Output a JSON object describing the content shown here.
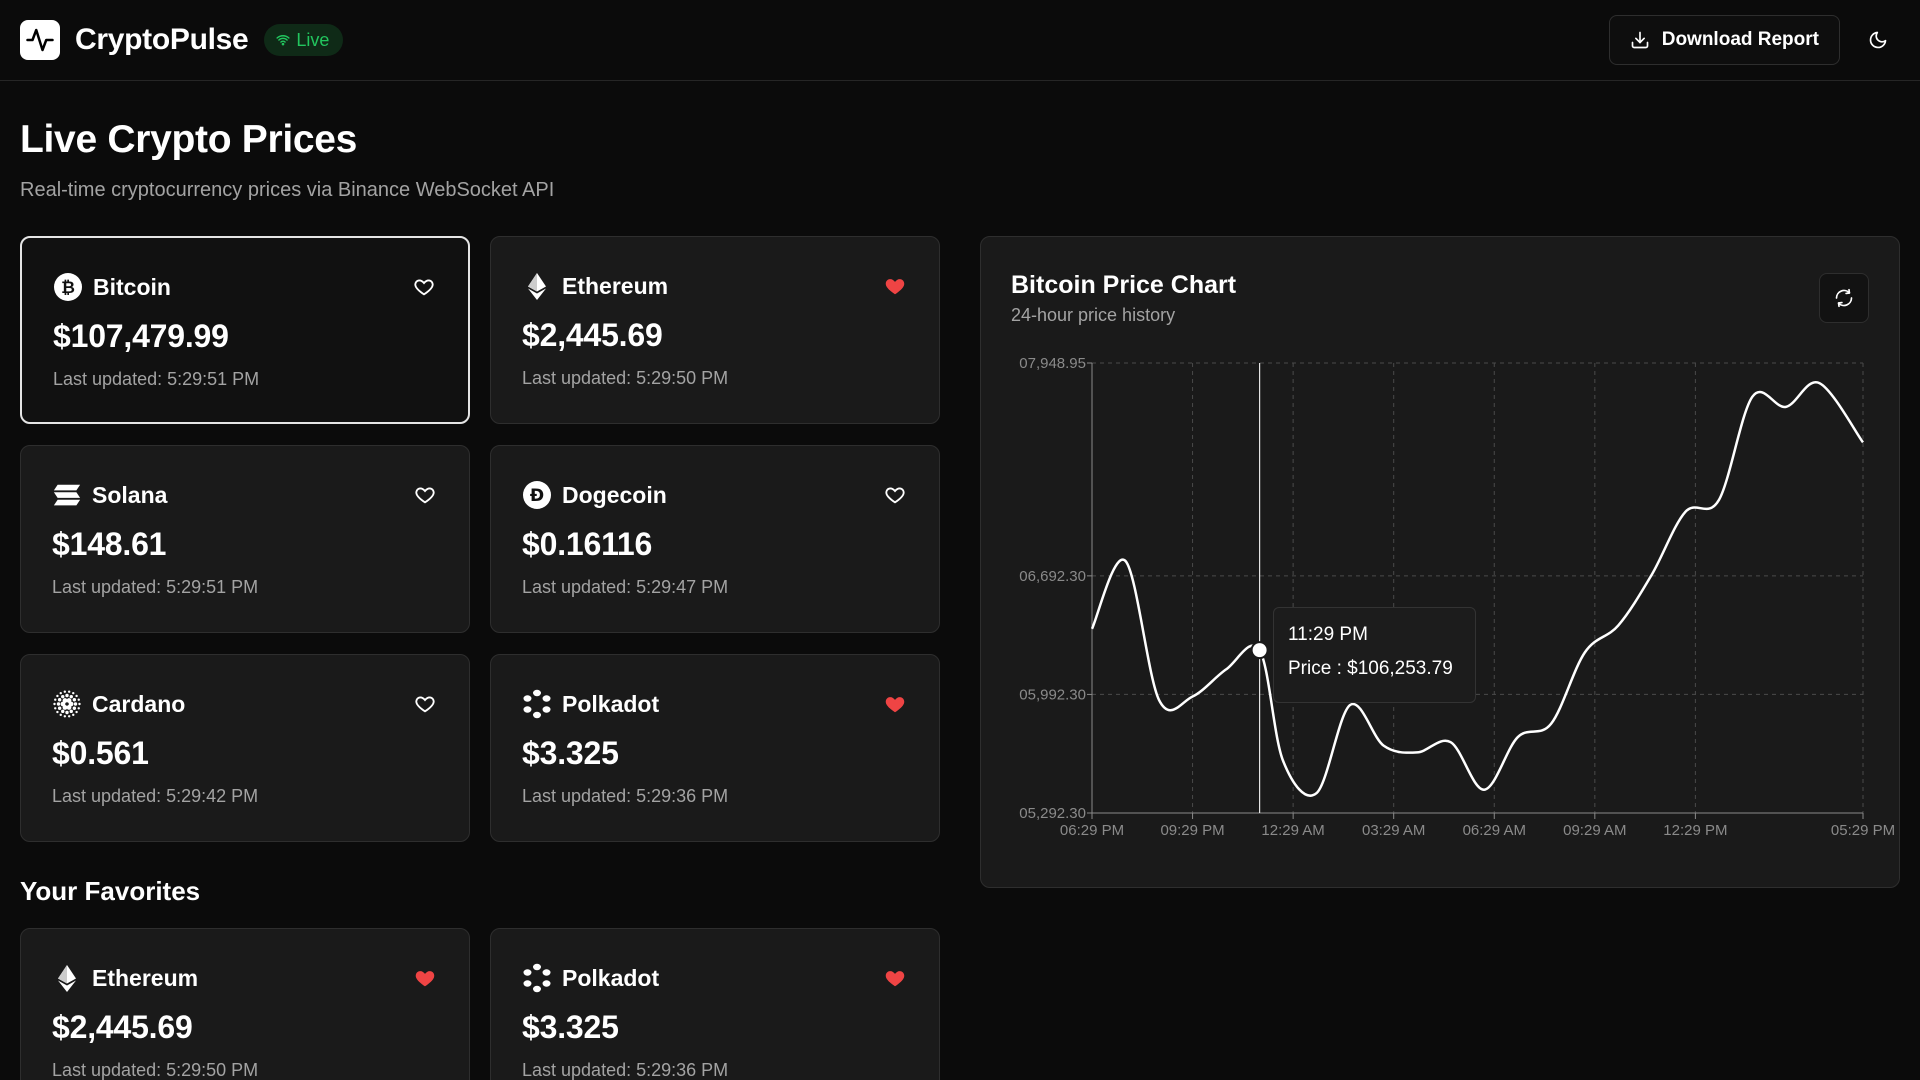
{
  "header": {
    "brand": "CryptoPulse",
    "live_label": "Live",
    "download_label": "Download Report"
  },
  "page": {
    "title": "Live Crypto Prices",
    "subtitle": "Real-time cryptocurrency prices via Binance WebSocket API"
  },
  "coins": [
    {
      "name": "Bitcoin",
      "price": "$107,479.99",
      "updated": "Last updated: 5:29:51 PM",
      "icon": "bitcoin-icon",
      "favorite": false,
      "selected": true
    },
    {
      "name": "Ethereum",
      "price": "$2,445.69",
      "updated": "Last updated: 5:29:50 PM",
      "icon": "ethereum-icon",
      "favorite": true,
      "selected": false
    },
    {
      "name": "Solana",
      "price": "$148.61",
      "updated": "Last updated: 5:29:51 PM",
      "icon": "solana-icon",
      "favorite": false,
      "selected": false
    },
    {
      "name": "Dogecoin",
      "price": "$0.16116",
      "updated": "Last updated: 5:29:47 PM",
      "icon": "dogecoin-icon",
      "favorite": false,
      "selected": false
    },
    {
      "name": "Cardano",
      "price": "$0.561",
      "updated": "Last updated: 5:29:42 PM",
      "icon": "cardano-icon",
      "favorite": false,
      "selected": false
    },
    {
      "name": "Polkadot",
      "price": "$3.325",
      "updated": "Last updated: 5:29:36 PM",
      "icon": "polkadot-icon",
      "favorite": true,
      "selected": false
    }
  ],
  "favorites": {
    "title": "Your Favorites",
    "items": [
      {
        "name": "Ethereum",
        "price": "$2,445.69",
        "updated": "Last updated: 5:29:50 PM",
        "icon": "ethereum-icon"
      },
      {
        "name": "Polkadot",
        "price": "$3.325",
        "updated": "Last updated: 5:29:36 PM",
        "icon": "polkadot-icon"
      }
    ]
  },
  "chart": {
    "title": "Bitcoin Price Chart",
    "subtitle": "24-hour price history",
    "tooltip": {
      "time": "11:29 PM",
      "price": "Price : $106,253.79"
    }
  },
  "colors": {
    "background": "#0b0b0b",
    "card": "#1a1a1a",
    "border": "#2e2e2e",
    "live_green": "#22c55e",
    "favorite_red": "#ef4444",
    "muted_text": "#a3a3a3"
  },
  "chart_data": {
    "type": "line",
    "title": "Bitcoin Price Chart",
    "subtitle": "24-hour price history",
    "y_ticks": [
      "07,948.95",
      "06,692.30",
      "05,992.30",
      "05,292.30"
    ],
    "y_tick_values": [
      107948.95,
      106692.3,
      105992.3,
      105292.3
    ],
    "x_ticks": [
      "06:29 PM",
      "09:29 PM",
      "12:29 AM",
      "03:29 AM",
      "06:29 AM",
      "09:29 AM",
      "12:29 PM",
      "05:29 PM"
    ],
    "x_tick_hours": [
      0,
      3,
      6,
      9,
      12,
      15,
      18,
      23
    ],
    "ylim": [
      105292.3,
      107948.95
    ],
    "grid": true,
    "series": [
      {
        "values": [
          [
            0,
            106380
          ],
          [
            1,
            106780
          ],
          [
            2,
            105960
          ],
          [
            3,
            105980
          ],
          [
            4,
            106140
          ],
          [
            5,
            106253.79
          ],
          [
            5.7,
            105600
          ],
          [
            6.7,
            105410
          ],
          [
            7.7,
            105930
          ],
          [
            8.7,
            105690
          ],
          [
            9.7,
            105650
          ],
          [
            10.7,
            105710
          ],
          [
            11.7,
            105430
          ],
          [
            12.7,
            105740
          ],
          [
            13.7,
            105820
          ],
          [
            14.7,
            106240
          ],
          [
            15.7,
            106400
          ],
          [
            16.7,
            106700
          ],
          [
            17.7,
            107070
          ],
          [
            18.7,
            107140
          ],
          [
            19.7,
            107750
          ],
          [
            20.7,
            107690
          ],
          [
            21.7,
            107830
          ],
          [
            23,
            107480
          ]
        ]
      }
    ],
    "highlight": {
      "x": 5,
      "y": 106253.79,
      "label": "11:29 PM"
    }
  }
}
